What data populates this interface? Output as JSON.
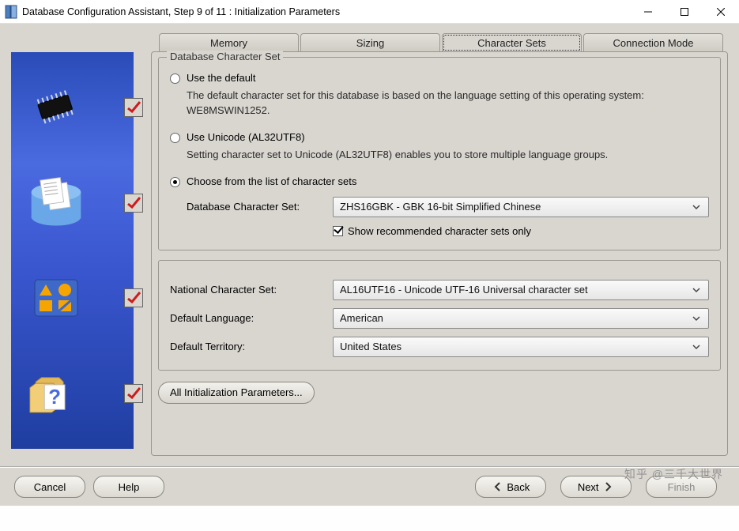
{
  "window": {
    "title": "Database Configuration Assistant, Step 9 of 11 : Initialization Parameters"
  },
  "tabs": {
    "memory": "Memory",
    "sizing": "Sizing",
    "character_sets": "Character Sets",
    "connection_mode": "Connection Mode"
  },
  "db_charset_group": {
    "legend": "Database Character Set",
    "use_default_label": "Use the default",
    "use_default_desc": "The default character set for this database is based on the language setting of this operating system: WE8MSWIN1252.",
    "use_unicode_label": "Use Unicode (AL32UTF8)",
    "use_unicode_desc": "Setting character set to Unicode (AL32UTF8) enables you to store multiple language groups.",
    "choose_list_label": "Choose from the list of character sets",
    "db_charset_field_label": "Database Character Set:",
    "db_charset_value": "ZHS16GBK - GBK 16-bit Simplified Chinese",
    "show_recommended_label": "Show recommended character sets only"
  },
  "lower_group": {
    "national_label": "National Character Set:",
    "national_value": "AL16UTF16 - Unicode UTF-16 Universal character set",
    "default_language_label": "Default Language:",
    "default_language_value": "American",
    "default_territory_label": "Default Territory:",
    "default_territory_value": "United States"
  },
  "buttons": {
    "all_params": "All Initialization Parameters...",
    "cancel": "Cancel",
    "help": "Help",
    "back": "Back",
    "next": "Next",
    "finish": "Finish"
  },
  "watermark": "知乎 @三千大世界"
}
